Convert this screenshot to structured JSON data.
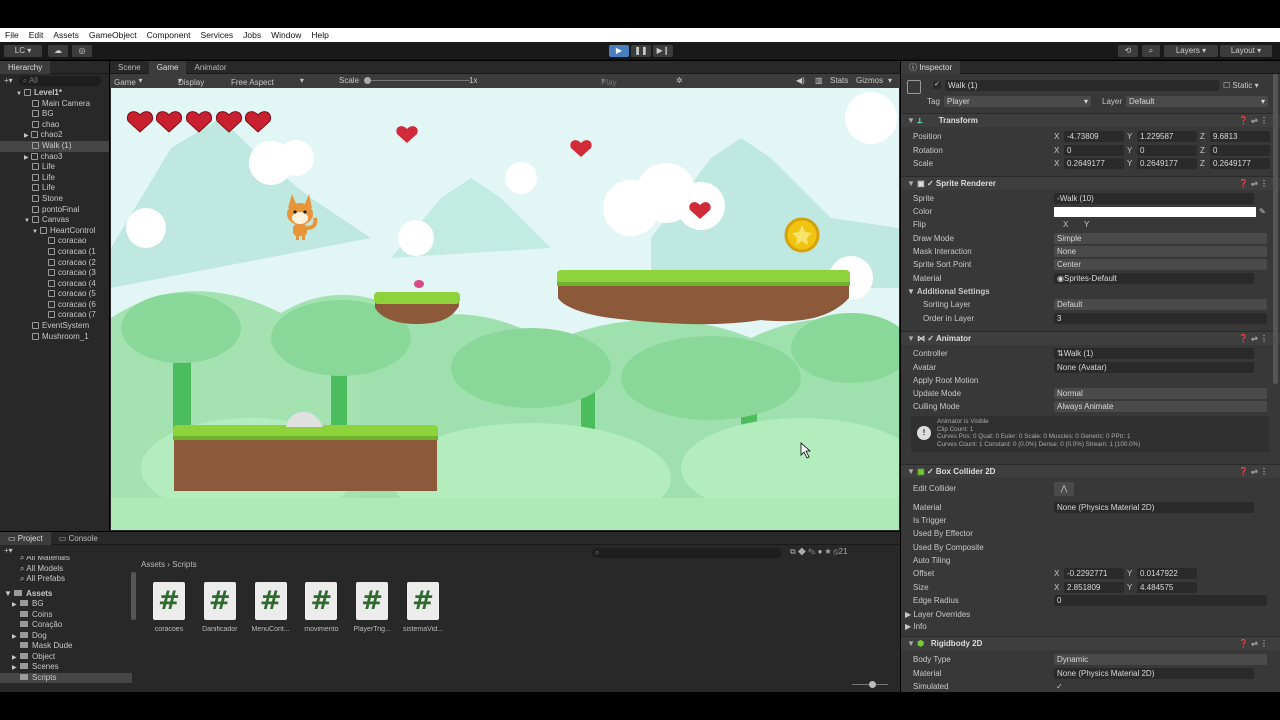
{
  "menubar": [
    "File",
    "Edit",
    "Assets",
    "GameObject",
    "Component",
    "Services",
    "Jobs",
    "Window",
    "Help"
  ],
  "toolbar": {
    "account": "LC",
    "layers": "Layers",
    "layout": "Layout"
  },
  "hierarchy": {
    "tab": "Hierarchy",
    "search": "All",
    "items": [
      {
        "label": "Level1*",
        "indent": 0,
        "arrow": "▼"
      },
      {
        "label": "Main Camera",
        "indent": 1
      },
      {
        "label": "BG",
        "indent": 1
      },
      {
        "label": "chao",
        "indent": 1
      },
      {
        "label": "chao2",
        "indent": 1,
        "arrow": "▶"
      },
      {
        "label": "Walk (1)",
        "indent": 1,
        "selected": true
      },
      {
        "label": "chao3",
        "indent": 1,
        "arrow": "▶"
      },
      {
        "label": "Life",
        "indent": 1
      },
      {
        "label": "Life",
        "indent": 1
      },
      {
        "label": "Life",
        "indent": 1
      },
      {
        "label": "Stone",
        "indent": 1
      },
      {
        "label": "pontoFinal",
        "indent": 1
      },
      {
        "label": "Canvas",
        "indent": 1,
        "arrow": "▼"
      },
      {
        "label": "HeartControl",
        "indent": 2,
        "arrow": "▼"
      },
      {
        "label": "coracao",
        "indent": 3
      },
      {
        "label": "coracao (1",
        "indent": 3
      },
      {
        "label": "coracao (2",
        "indent": 3
      },
      {
        "label": "coracao (3",
        "indent": 3
      },
      {
        "label": "coracao (4",
        "indent": 3
      },
      {
        "label": "coracao (5",
        "indent": 3
      },
      {
        "label": "coracao (6",
        "indent": 3
      },
      {
        "label": "coracao (7",
        "indent": 3
      },
      {
        "label": "EventSystem",
        "indent": 1
      },
      {
        "label": "Mushroom_1",
        "indent": 1
      }
    ]
  },
  "game": {
    "tabs": [
      "Scene",
      "Game",
      "Animator"
    ],
    "mode": "Game",
    "display": "Display 1",
    "aspect": "Free Aspect",
    "scale_label": "Scale",
    "scale_value": "1x",
    "play_focused": "Play Focused",
    "stats": "Stats",
    "gizmos": "Gizmos"
  },
  "inspector": {
    "tab": "Inspector",
    "name": "Walk (1)",
    "static": "Static",
    "tag_label": "Tag",
    "tag": "Player",
    "layer_label": "Layer",
    "layer": "Default",
    "transform": {
      "title": "Transform",
      "position": [
        "-4.73809",
        "1.229587",
        "9.6813"
      ],
      "rotation": [
        "0",
        "0",
        "0"
      ],
      "scale": [
        "0.2649177",
        "0.2649177",
        "0.2649177"
      ]
    },
    "sprite_renderer": {
      "title": "Sprite Renderer",
      "sprite": "Walk (10)",
      "draw_mode": "Simple",
      "mask_interaction": "None",
      "sort_point": "Center",
      "material": "Sprites-Default",
      "sorting_layer": "Default",
      "order": "3"
    },
    "animator": {
      "title": "Animator",
      "controller": "Walk (1)",
      "avatar": "None (Avatar)",
      "update_mode": "Normal",
      "culling_mode": "Always Animate",
      "info": [
        "Animator is Visible",
        "Clip Count: 1",
        "Curves Pos: 0 Quat: 0 Euler: 0 Scale: 0 Muscles: 0 Generic: 0 PPtr: 1",
        "Curves Count: 1 Constant: 0 (0.0%) Dense: 0 (0.0%) Stream: 1 (100.0%)"
      ]
    },
    "box_collider": {
      "title": "Box Collider 2D",
      "material": "None (Physics Material 2D)",
      "offset": [
        "-0.2292771",
        "0.0147922"
      ],
      "size": [
        "2.851809",
        "4.484575"
      ],
      "edge_radius": "0"
    },
    "rigidbody": {
      "title": "Rigidbody 2D",
      "body_type": "Dynamic",
      "material": "None (Physics Material 2D)"
    }
  },
  "project": {
    "tabs": [
      "Project",
      "Console"
    ],
    "favorites": [
      "All Materials",
      "All Models",
      "All Prefabs"
    ],
    "assets_root": "Assets",
    "folders": [
      "BG",
      "Coins",
      "Coração",
      "Dog",
      "Mask Dude",
      "Object",
      "Scenes",
      "Scripts"
    ],
    "breadcrumb": [
      "Assets",
      "Scripts"
    ],
    "count": "21",
    "scripts": [
      "coracoes",
      "Danificador",
      "MenuCont...",
      "movimento",
      "PlayerTrig...",
      "sistemaVid..."
    ]
  }
}
